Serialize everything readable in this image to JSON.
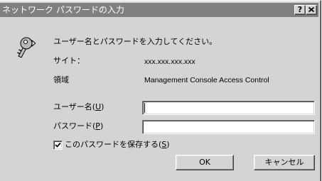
{
  "window": {
    "title": "ネットワーク パスワードの入力",
    "help_button": "?",
    "icons": {
      "help": "help-icon",
      "close": "close-icon",
      "dialog": "key-icon"
    }
  },
  "prompt": "ユーザー名とパスワードを入力してください。",
  "site": {
    "label": "サイト：",
    "value": "xxx.xxx.xxx.xxx"
  },
  "realm": {
    "label": "領域",
    "value": "Management Console Access Control"
  },
  "username": {
    "label": "ユーザー名(",
    "accel": "U",
    "label_end": ")",
    "value": ""
  },
  "password": {
    "label": "パスワード(",
    "accel": "P",
    "label_end": ")",
    "value": ""
  },
  "save_password": {
    "label": "このパスワードを保存する(",
    "accel": "S",
    "label_end": ")",
    "checked": true
  },
  "buttons": {
    "ok": "OK",
    "cancel": "キャンセル"
  },
  "colors": {
    "title_bar": "#808080",
    "title_text": "#ffffff",
    "face": "#d4d4d4"
  }
}
